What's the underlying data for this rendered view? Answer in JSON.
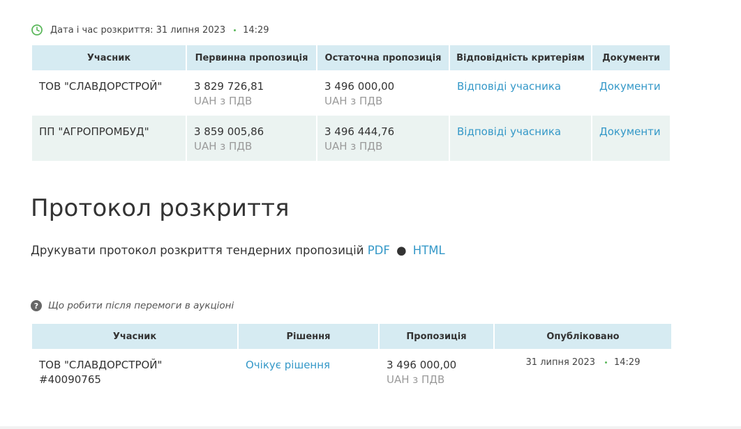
{
  "auction": {
    "opening_label": "Дата і час розкриття:",
    "opening_date": "31 липня 2023",
    "opening_time": "14:29",
    "icon": "clock-icon",
    "columns": {
      "participant": "Учасник",
      "initial": "Первинна пропозиція",
      "final": "Остаточна пропозиція",
      "criteria": "Відповідність критеріям",
      "documents": "Документи"
    },
    "rows": [
      {
        "participant": "ТОВ \"СЛАВДОРСТРОЙ\"",
        "initial_amount": "3 829 726,81",
        "initial_currency": "UAH з ПДВ",
        "final_amount": "3 496 000,00",
        "final_currency": "UAH з ПДВ",
        "criteria_link": "Відповіді учасника",
        "documents_link": "Документи"
      },
      {
        "participant": "ПП \"АГРОПРОМБУД\"",
        "initial_amount": "3 859 005,86",
        "initial_currency": "UAH з ПДВ",
        "final_amount": "3 496 444,76",
        "final_currency": "UAH з ПДВ",
        "criteria_link": "Відповіді учасника",
        "documents_link": "Документи"
      }
    ]
  },
  "protocol": {
    "title": "Протокол розкриття",
    "print_text": "Друкувати протокол розкриття тендерних пропозицій",
    "pdf_link": "PDF",
    "bullet": "●",
    "html_link": "HTML"
  },
  "help": {
    "icon": "question-icon",
    "text": "Що робити після перемоги в аукціоні"
  },
  "decisions": {
    "columns": {
      "participant": "Учасник",
      "decision": "Рішення",
      "offer": "Пропозиція",
      "published": "Опубліковано"
    },
    "rows": [
      {
        "participant": "ТОВ \"СЛАВДОРСТРОЙ\"",
        "participant_code": "#40090765",
        "decision_link": "Очікує рішення",
        "offer_amount": "3 496 000,00",
        "offer_currency": "UAH з ПДВ",
        "published_date": "31 липня 2023",
        "published_time": "14:29"
      }
    ]
  },
  "colors": {
    "header_bg": "#d6ebf2",
    "shaded_row_bg": "#ebf3f1",
    "link": "#3498c8",
    "clock_icon": "#5cb85c",
    "muted_text": "#9a9a9a"
  }
}
